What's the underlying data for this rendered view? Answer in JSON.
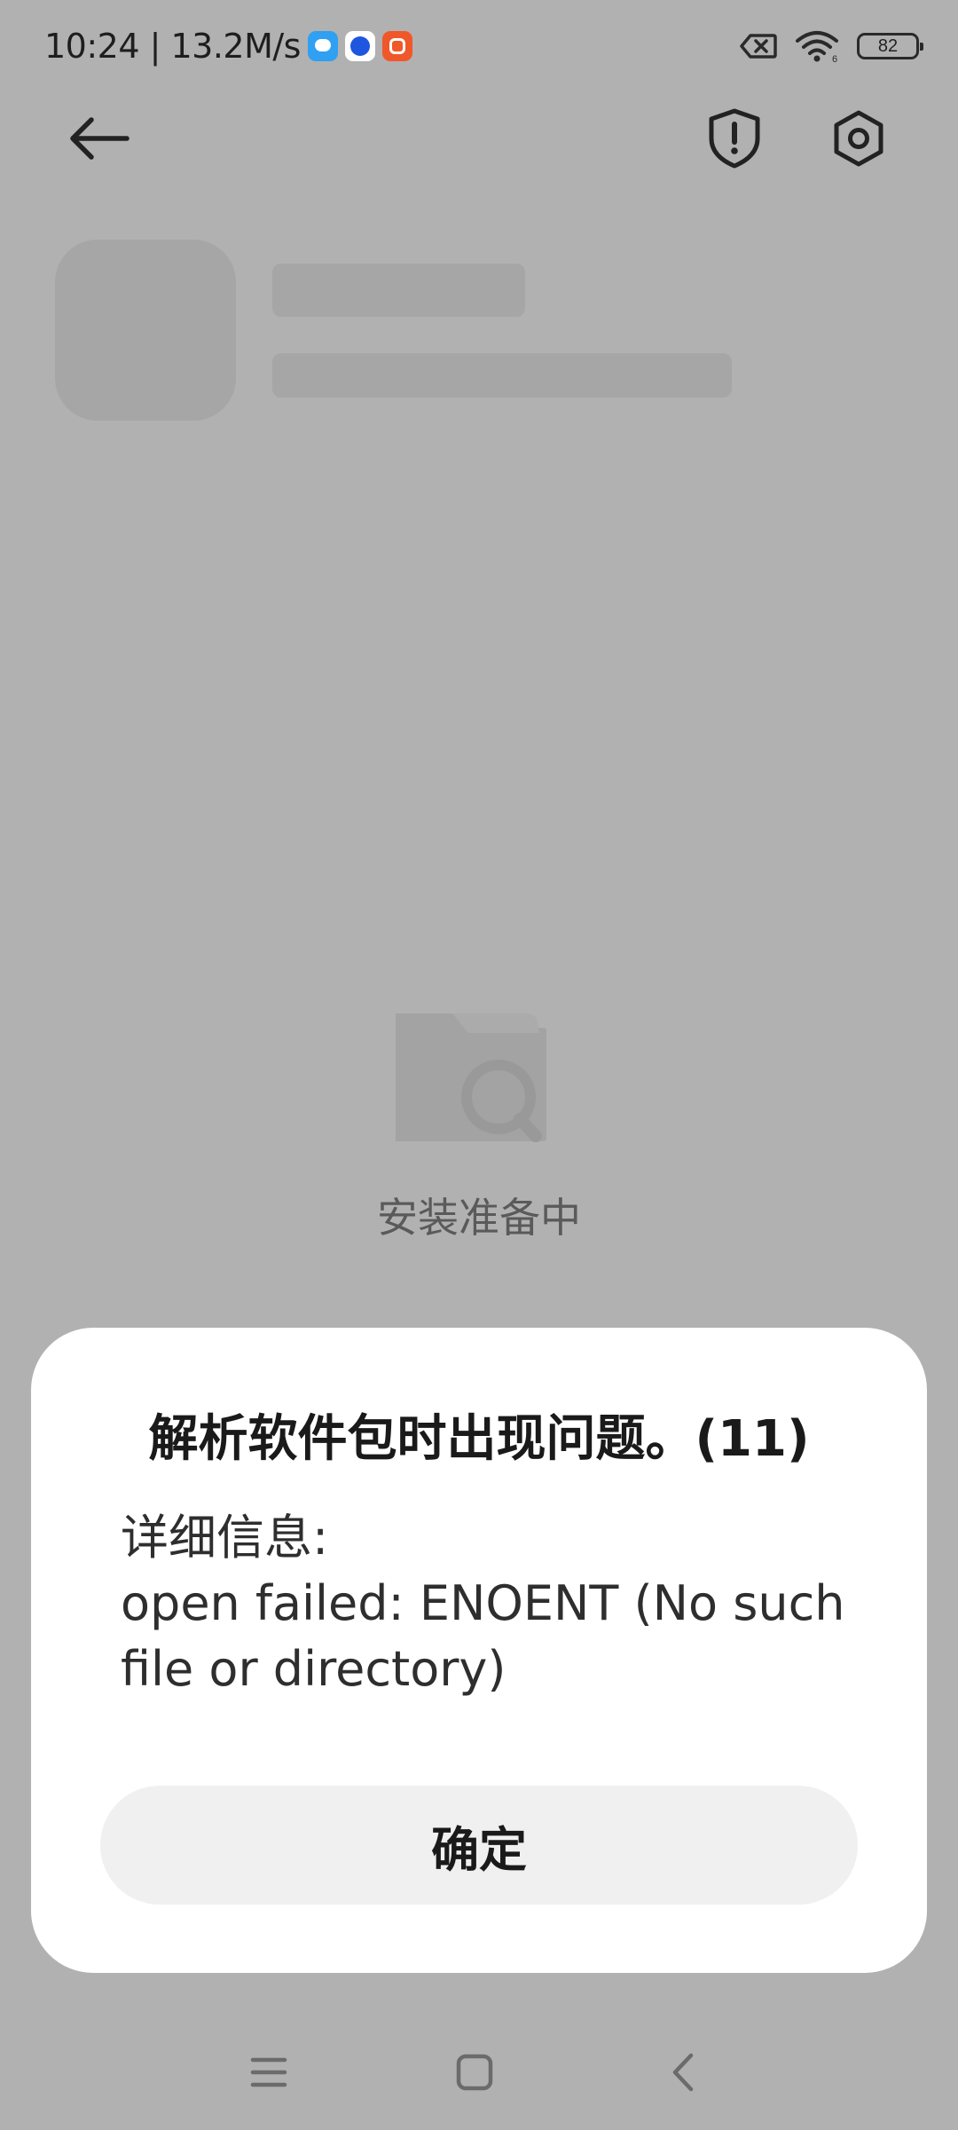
{
  "status_bar": {
    "time_speed": "10:24 | 13.2M/s",
    "notification_icons": [
      "message-app-icon",
      "browser-app-icon",
      "store-app-icon"
    ],
    "system_icons": [
      "no-sim-icon",
      "wifi-icon"
    ],
    "battery_level": "82"
  },
  "toolbar": {
    "back_icon": "back-arrow-icon",
    "shield_icon": "security-shield-icon",
    "settings_icon": "settings-gear-icon"
  },
  "loading": {
    "icon": "folder-search-icon",
    "text": "安装准备中"
  },
  "dialog": {
    "title": "解析软件包时出现问题。(11)",
    "details_label": "详细信息:",
    "details_text": "open failed: ENOENT (No such file or directory)",
    "confirm_label": "确定"
  },
  "nav_bar": {
    "icons": [
      "menu-icon",
      "home-icon",
      "back-icon"
    ]
  },
  "colors": {
    "scrim_background": "#b1b1b1",
    "dialog_background": "#ffffff",
    "button_background": "#f0f0f0"
  }
}
